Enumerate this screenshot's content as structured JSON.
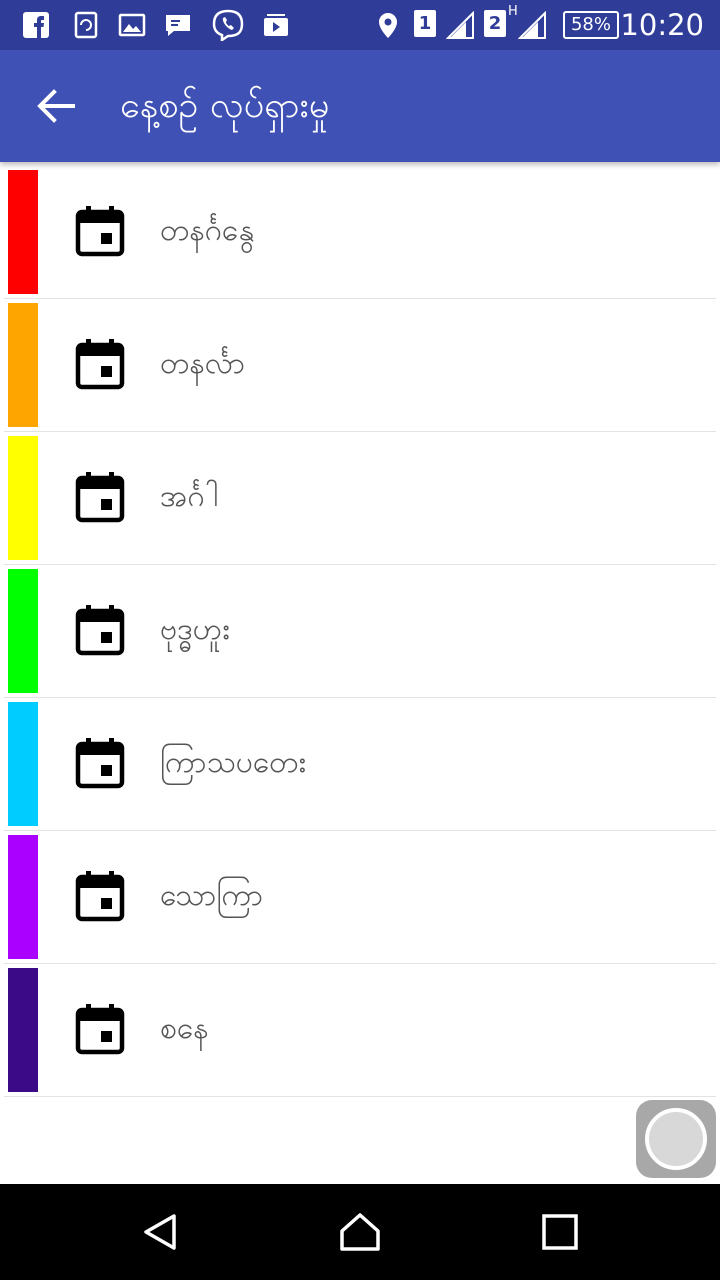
{
  "status_bar": {
    "time": "10:20",
    "battery": "58%",
    "sim1": "1",
    "sim2": "2",
    "network_type": "H",
    "icons": [
      "facebook-icon",
      "sync-icon",
      "gallery-icon",
      "message-icon",
      "viber-icon",
      "video-icon",
      "location-icon"
    ]
  },
  "app_bar": {
    "title": "နေ့စဉ် လုပ်ရှားမှု",
    "back_icon": "arrow-back-icon"
  },
  "days": [
    {
      "label": "တနင်္ဂနွေ",
      "color": "#ff0000"
    },
    {
      "label": "တနင်္လာ",
      "color": "#ffa500"
    },
    {
      "label": "အင်္ဂါ",
      "color": "#ffff00"
    },
    {
      "label": "ဗုဒ္ဓဟူး",
      "color": "#00ff00"
    },
    {
      "label": "ကြာသပတေး",
      "color": "#00ccff"
    },
    {
      "label": "သောကြာ",
      "color": "#aa00ff"
    },
    {
      "label": "စနေ",
      "color": "#3a0a87"
    }
  ],
  "day_icon": "calendar-today-icon",
  "theme": {
    "primary": "#3f51b5",
    "primary_dark": "#2f3d99"
  }
}
